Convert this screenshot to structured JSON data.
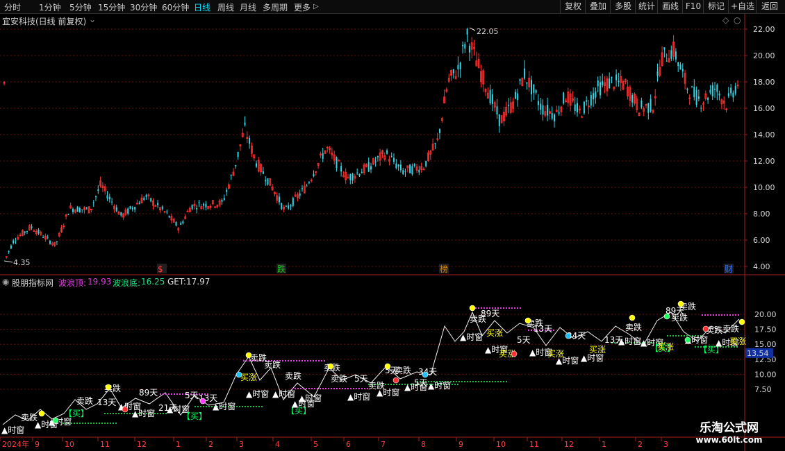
{
  "toolbar": {
    "periods": [
      "分时",
      "1分钟",
      "5分钟",
      "15分钟",
      "30分钟",
      "60分钟",
      "日线",
      "周线",
      "月线",
      "多周期",
      "更多"
    ],
    "active_period": "日线",
    "buttons": [
      "复权",
      "叠加",
      "多股",
      "统计",
      "画线",
      "F10",
      "+自选",
      "返回"
    ],
    "right_extra": "标记"
  },
  "stock": {
    "name": "宜安科技(日线 前复权)"
  },
  "main_chart": {
    "high_label": "22.05",
    "low_label": "4.35",
    "yticks": [
      "22.00",
      "20.00",
      "18.00",
      "16.00",
      "14.00",
      "12.00",
      "10.00",
      "8.00",
      "6.00",
      "4.00"
    ],
    "events": [
      {
        "label": "$",
        "color": "#ff4040"
      },
      {
        "label": "跌",
        "color": "#20c020"
      },
      {
        "label": "榜",
        "color": "#e08000"
      },
      {
        "label": "财",
        "color": "#3070ff"
      }
    ]
  },
  "indicator": {
    "name": "股朋指标网",
    "top_label": "波浪顶:",
    "top_value": "19.93",
    "bottom_label": "波浪底:",
    "bottom_value": "16.25",
    "get_label": "GET:",
    "get_value": "17.97",
    "yticks": [
      "20.00",
      "17.50",
      "15.00",
      "12.50",
      "10.00",
      "7.50"
    ],
    "price_tag": "13.54"
  },
  "xaxis": {
    "labels": [
      "2024年",
      "9",
      "10",
      "11",
      "12",
      "1",
      "2",
      "3",
      "4",
      "5",
      "6",
      "7",
      "8",
      "9",
      "10",
      "11",
      "12",
      "1",
      "2",
      "3"
    ]
  },
  "annotations": [
    {
      "t": "卖跌",
      "c": "#ffffff"
    },
    {
      "t": "▲时窗",
      "c": "#ffffff"
    },
    {
      "t": "买涨",
      "c": "#ffff00"
    },
    {
      "t": "5天",
      "c": "#ffffff"
    },
    {
      "t": "13天",
      "c": "#ffffff"
    },
    {
      "t": "34天",
      "c": "#ffffff"
    },
    {
      "t": "21天",
      "c": "#ffffff"
    },
    {
      "t": "89天",
      "c": "#ffffff"
    },
    {
      "t": "【买】",
      "c": "#00ff60"
    }
  ],
  "watermark": {
    "line1": "乐淘公式网",
    "line2": "www.60lt.com"
  }
}
